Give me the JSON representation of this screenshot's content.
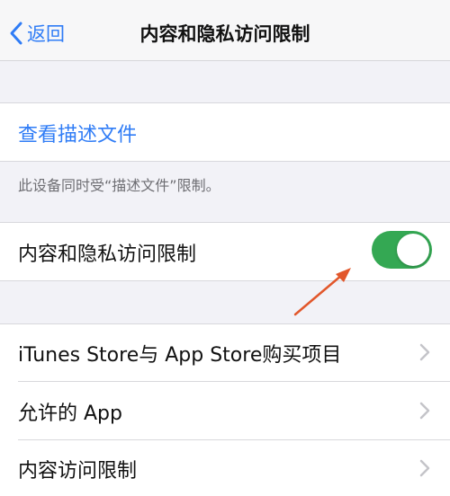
{
  "nav": {
    "back_label": "返回",
    "title": "内容和隐私访问限制"
  },
  "profile": {
    "view_label": "查看描述文件",
    "footer_note": "此设备同时受“描述文件”限制。"
  },
  "restrictions": {
    "label": "内容和隐私访问限制",
    "enabled": true
  },
  "menu": {
    "items": [
      {
        "label": "iTunes Store与 App Store购买项目"
      },
      {
        "label": "允许的 App"
      },
      {
        "label": "内容访问限制"
      }
    ]
  },
  "colors": {
    "accent": "#2f7cf6",
    "toggle_on": "#34a853",
    "annotation_arrow": "#e2572b"
  }
}
